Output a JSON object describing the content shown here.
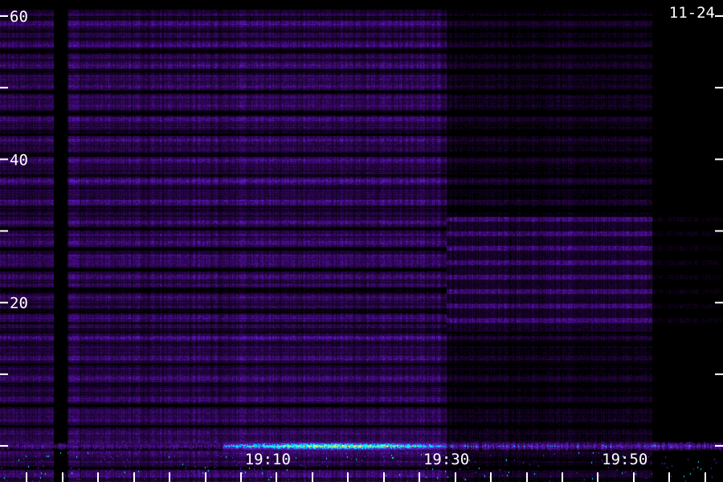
{
  "chart_data": {
    "type": "heatmap",
    "date_label": "11-24",
    "y_range": [
      0,
      60
    ],
    "y_tick_labels": [
      {
        "value": 60,
        "text": "60"
      },
      {
        "value": 40,
        "text": "40"
      },
      {
        "value": 20,
        "text": "20"
      }
    ],
    "y_minor_ticks": [
      0,
      10,
      20,
      30,
      40,
      50,
      60
    ],
    "x_range_minutes": [
      -20,
      61
    ],
    "x_tick_labels": [
      {
        "minute": 10,
        "text": "19:10"
      },
      {
        "minute": 30,
        "text": "19:30"
      },
      {
        "minute": 50,
        "text": "19:50"
      }
    ],
    "x_tick_minutes": [
      -17,
      -13,
      -9,
      -5,
      -1,
      3,
      7,
      11,
      15,
      19,
      23,
      27,
      31,
      35,
      39,
      43,
      47,
      51,
      55,
      59
    ],
    "segments": [
      {
        "start": -20,
        "end": -14,
        "level": 0.35
      },
      {
        "start": -14,
        "end": -12.5,
        "level": 0.05
      },
      {
        "start": -12.5,
        "end": 30,
        "level": 0.42
      },
      {
        "start": 30,
        "end": 53,
        "level": 0.18
      },
      {
        "start": 53,
        "end": 61,
        "level": 0.04
      }
    ],
    "colors": {
      "background": "#000000",
      "low": "#3a0a6a",
      "mid": "#5a20c8",
      "high": "#00e8ff",
      "peak": "#ffff40",
      "axis": "#ffffff"
    }
  }
}
